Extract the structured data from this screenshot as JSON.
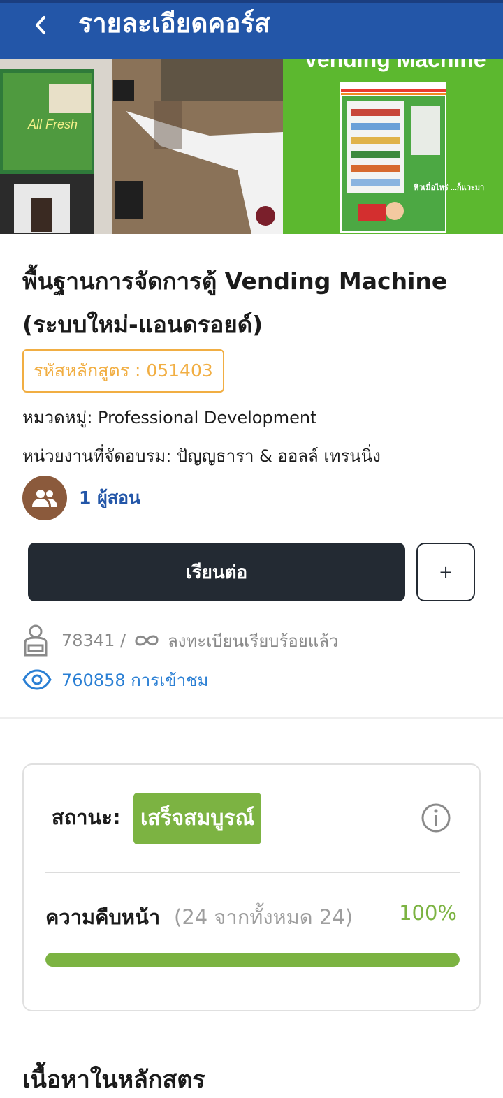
{
  "header": {
    "title": "รายละเอียดคอร์ส",
    "back_icon": "chevron-left-icon"
  },
  "banner": {
    "sign_text": "Vending Machine",
    "promo_text": "All Fresh",
    "machine_text": "หิวเมื่อไหร่ ...ก็แวะมา"
  },
  "course": {
    "title_line1": "พื้นฐานการจัดการตู้ Vending Machine",
    "title_line2": "(ระบบใหม่-แอนดรอยด์)",
    "code": "รหัสหลักสูตร : 051403",
    "category": "หมวดหมู่: Professional Development",
    "organizer": "หน่วยงานที่จัดอบรม: ปัญญธารา & ออลล์ เทรนนิ่ง",
    "instructors": "1 ผู้สอน"
  },
  "actions": {
    "continue_label": "เรียนต่อ",
    "add_label": "+"
  },
  "stats": {
    "enrolled_count": "78341 /",
    "enrolled_label": "ลงทะเบียนเรียบร้อยแล้ว",
    "views": "760858 การเข้าชม"
  },
  "status": {
    "label": "สถานะ:",
    "value": "เสร็จสมบูรณ์",
    "progress_label": "ความคืบหน้า",
    "progress_count": "(24 จากทั้งหมด 24)",
    "progress_percent": "100%",
    "progress_fraction": 1.0
  },
  "content": {
    "section_title": "เนื้อหาในหลักสตร"
  },
  "colors": {
    "header": "#2356a8",
    "accent_orange": "#f1ae43",
    "success_green": "#7cb342",
    "dark_button": "#232a33",
    "link_blue": "#2a7fd4"
  }
}
